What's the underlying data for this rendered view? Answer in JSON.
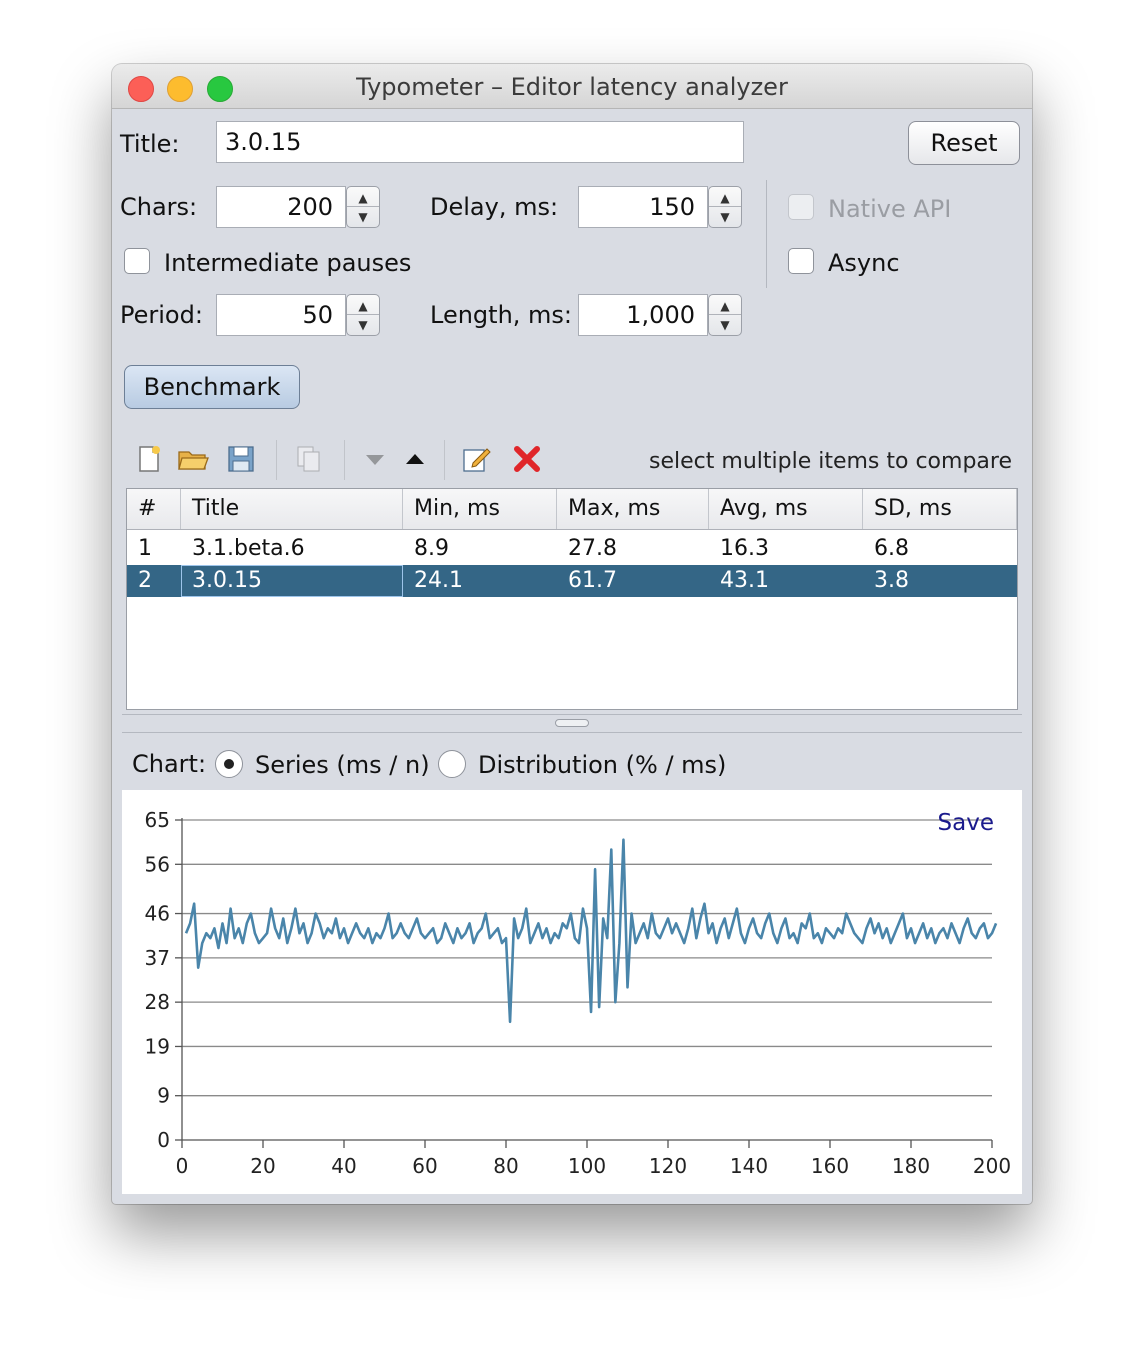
{
  "window": {
    "title": "Typometer – Editor latency analyzer"
  },
  "form": {
    "title_label": "Title:",
    "title_value": "3.0.15",
    "reset_label": "Reset",
    "chars_label": "Chars:",
    "chars_value": "200",
    "delay_label": "Delay, ms:",
    "delay_value": "150",
    "native_api_label": "Native API",
    "async_label": "Async",
    "intermediate_pauses_label": "Intermediate  pauses",
    "period_label": "Period:",
    "period_value": "50",
    "length_label": "Length, ms:",
    "length_value": "1,000",
    "benchmark_label": "Benchmark"
  },
  "toolbar": {
    "hint": "select multiple items to compare",
    "icons": [
      "new-file-icon",
      "open-folder-icon",
      "save-icon",
      "copy-icon",
      "move-down-icon",
      "move-up-icon",
      "edit-icon",
      "delete-icon"
    ]
  },
  "table": {
    "columns": [
      "#",
      "Title",
      "Min, ms",
      "Max, ms",
      "Avg, ms",
      "SD, ms"
    ],
    "rows": [
      {
        "num": "1",
        "title": "3.1.beta.6",
        "min": "8.9",
        "max": "27.8",
        "avg": "16.3",
        "sd": "6.8",
        "selected": false
      },
      {
        "num": "2",
        "title": "3.0.15",
        "min": "24.1",
        "max": "61.7",
        "avg": "43.1",
        "sd": "3.8",
        "selected": true
      }
    ]
  },
  "chart_controls": {
    "label": "Chart:",
    "series_label": "Series (ms / n)",
    "distribution_label": "Distribution (% / ms)",
    "selected": "series",
    "save_label": "Save"
  },
  "colors": {
    "selection": "#346686",
    "series_line": "#4a85aa",
    "save_link": "#1a1a8c"
  },
  "chart_data": {
    "type": "line",
    "xlim": [
      0,
      200
    ],
    "ylim": [
      0,
      65
    ],
    "yticks": [
      0,
      9,
      19,
      28,
      37,
      46,
      56,
      65
    ],
    "xticks": [
      0,
      20,
      40,
      60,
      80,
      100,
      120,
      140,
      160,
      180,
      200
    ],
    "grid": true,
    "series": [
      {
        "values": [
          42,
          44,
          48,
          35,
          40,
          42,
          41,
          43,
          39,
          44,
          40,
          47,
          41,
          43,
          40,
          44,
          46,
          42,
          40,
          41,
          42,
          47,
          43,
          41,
          45,
          40,
          43,
          47,
          42,
          44,
          40,
          42,
          46,
          44,
          41,
          43,
          42,
          45,
          41,
          43,
          40,
          42,
          44,
          42,
          41,
          43,
          40,
          42,
          41,
          43,
          46,
          41,
          42,
          44,
          42,
          41,
          43,
          45,
          42,
          41,
          42,
          43,
          40,
          41,
          44,
          42,
          40,
          43,
          41,
          42,
          44,
          40,
          42,
          43,
          46,
          41,
          42,
          43,
          40,
          41,
          24,
          45,
          41,
          43,
          47,
          40,
          42,
          44,
          41,
          43,
          40,
          42,
          41,
          44,
          43,
          46,
          41,
          40,
          47,
          43,
          26,
          55,
          27,
          45,
          41,
          59,
          28,
          40,
          61,
          31,
          46,
          40,
          42,
          44,
          41,
          46,
          42,
          41,
          43,
          45,
          42,
          44,
          42,
          40,
          43,
          47,
          41,
          45,
          48,
          42,
          44,
          40,
          43,
          45,
          41,
          44,
          47,
          42,
          40,
          43,
          45,
          42,
          41,
          44,
          46,
          42,
          40,
          43,
          45,
          41,
          42,
          40,
          44,
          43,
          46,
          41,
          42,
          40,
          43,
          42,
          41,
          43,
          42,
          46,
          44,
          42,
          41,
          40,
          43,
          45,
          42,
          44,
          41,
          43,
          40,
          42,
          44,
          46,
          41,
          43,
          40,
          42,
          44,
          41,
          43,
          40,
          42,
          43,
          41,
          44,
          42,
          40,
          43,
          45,
          42,
          41,
          43,
          44,
          41,
          42,
          44
        ]
      }
    ]
  }
}
